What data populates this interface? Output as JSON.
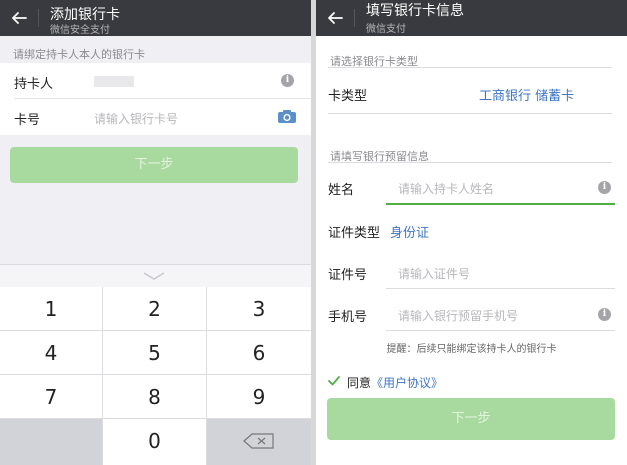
{
  "left": {
    "header": {
      "title": "添加银行卡",
      "subtitle": "微信安全支付"
    },
    "hint": "请绑定持卡人本人的银行卡",
    "cardholder": {
      "label": "持卡人",
      "value": ""
    },
    "card_number": {
      "label": "卡号",
      "placeholder": "请输入银行卡号"
    },
    "next_label": "下一步",
    "keypad": {
      "keys": [
        "1",
        "2",
        "3",
        "4",
        "5",
        "6",
        "7",
        "8",
        "9",
        "",
        "0"
      ]
    }
  },
  "right": {
    "header": {
      "title": "填写银行卡信息",
      "subtitle": "微信支付"
    },
    "section_card_type": "请选择银行卡类型",
    "card_type": {
      "label": "卡类型",
      "value": "工商银行 储蓄卡"
    },
    "section_reserved": "请填写银行预留信息",
    "name": {
      "label": "姓名",
      "placeholder": "请输入持卡人姓名"
    },
    "id_type": {
      "label": "证件类型",
      "value": "身份证"
    },
    "id_number": {
      "label": "证件号",
      "placeholder": "请输入证件号"
    },
    "phone": {
      "label": "手机号",
      "placeholder": "请输入银行预留手机号"
    },
    "tip": "提醒：后续只能绑定该持卡人的银行卡",
    "agree": {
      "text": "同意",
      "link": "《用户协议》",
      "checked": true
    },
    "next_label": "下一步"
  },
  "colors": {
    "topbar": "#393a3f",
    "button_disabled": "#a8d99f",
    "link_blue": "#3d75c4",
    "focus_green": "#52b043"
  }
}
